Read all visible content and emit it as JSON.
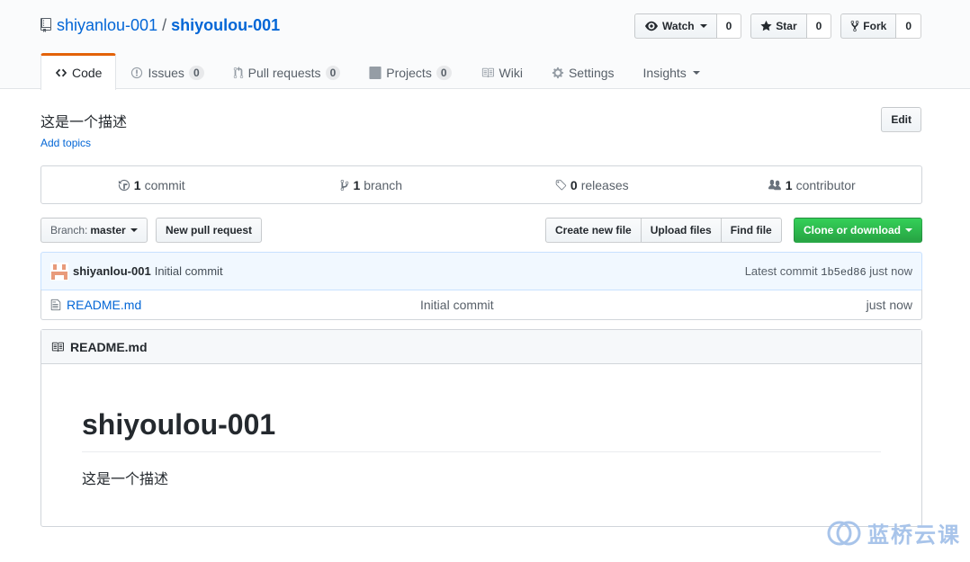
{
  "repo": {
    "owner": "shiyanlou-001",
    "separator": "/",
    "name": "shiyoulou-001"
  },
  "actions": {
    "watch_label": "Watch",
    "watch_count": "0",
    "star_label": "Star",
    "star_count": "0",
    "fork_label": "Fork",
    "fork_count": "0"
  },
  "tabs": [
    {
      "label": "Code",
      "icon": "code-icon"
    },
    {
      "label": "Issues",
      "count": "0",
      "icon": "issue-icon"
    },
    {
      "label": "Pull requests",
      "count": "0",
      "icon": "pr-icon"
    },
    {
      "label": "Projects",
      "count": "0",
      "icon": "project-icon"
    },
    {
      "label": "Wiki",
      "icon": "book-icon"
    },
    {
      "label": "Settings",
      "icon": "gear-icon"
    },
    {
      "label": "Insights",
      "icon": "caret-down-icon"
    }
  ],
  "description": "这是一个描述",
  "add_topics": "Add topics",
  "edit_label": "Edit",
  "summary": {
    "commits_num": "1",
    "commits_label": "commit",
    "branches_num": "1",
    "branches_label": "branch",
    "releases_num": "0",
    "releases_label": "releases",
    "contributors_num": "1",
    "contributors_label": "contributor"
  },
  "filenav": {
    "branch_prefix": "Branch:",
    "branch_name": "master",
    "new_pr": "New pull request",
    "create_file": "Create new file",
    "upload_files": "Upload files",
    "find_file": "Find file",
    "clone": "Clone or download"
  },
  "commit": {
    "author": "shiyanlou-001",
    "message": "Initial commit",
    "latest_label": "Latest commit",
    "sha": "1b5ed86",
    "age": "just now"
  },
  "files": [
    {
      "name": "README.md",
      "message": "Initial commit",
      "age": "just now"
    }
  ],
  "readme": {
    "filename": "README.md",
    "heading": "shiyoulou-001",
    "body": "这是一个描述"
  },
  "watermark": "蓝桥云课",
  "colors": {
    "link": "#0366d6",
    "tab_accent": "#e36209",
    "clone_green": "#28a745",
    "commit_bg": "#f1f8ff"
  }
}
